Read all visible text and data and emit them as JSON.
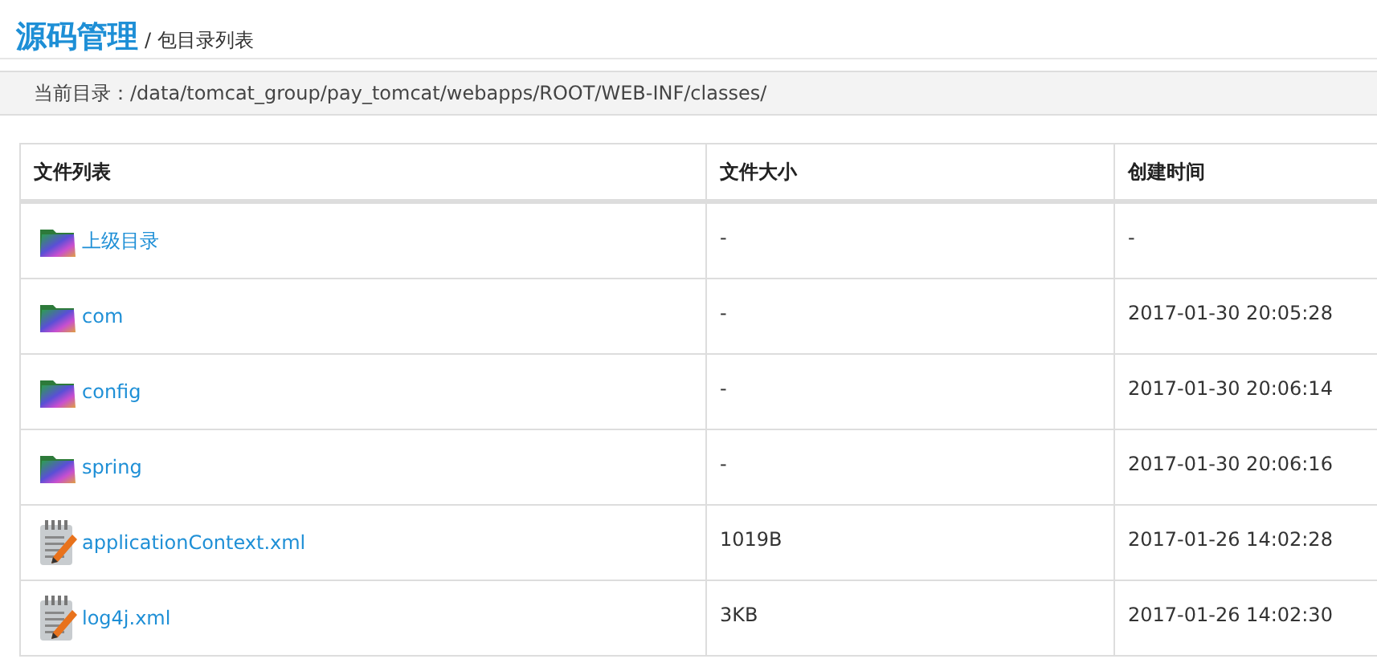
{
  "header": {
    "title": "源码管理",
    "subtitle": "/ 包目录列表"
  },
  "path_bar": {
    "label": "当前目录：",
    "path": "/data/tomcat_group/pay_tomcat/webapps/ROOT/WEB-INF/classes/"
  },
  "table": {
    "columns": [
      "文件列表",
      "文件大小",
      "创建时间"
    ],
    "rows": [
      {
        "kind": "folder",
        "name": "上级目录",
        "size": "-",
        "created": "-"
      },
      {
        "kind": "folder",
        "name": "com",
        "size": "-",
        "created": "2017-01-30 20:05:28"
      },
      {
        "kind": "folder",
        "name": "config",
        "size": "-",
        "created": "2017-01-30 20:06:14"
      },
      {
        "kind": "folder",
        "name": "spring",
        "size": "-",
        "created": "2017-01-30 20:06:16"
      },
      {
        "kind": "file",
        "name": "applicationContext.xml",
        "size": "1019B",
        "created": "2017-01-26 14:02:28"
      },
      {
        "kind": "file",
        "name": "log4j.xml",
        "size": "3KB",
        "created": "2017-01-26 14:02:30"
      }
    ]
  }
}
